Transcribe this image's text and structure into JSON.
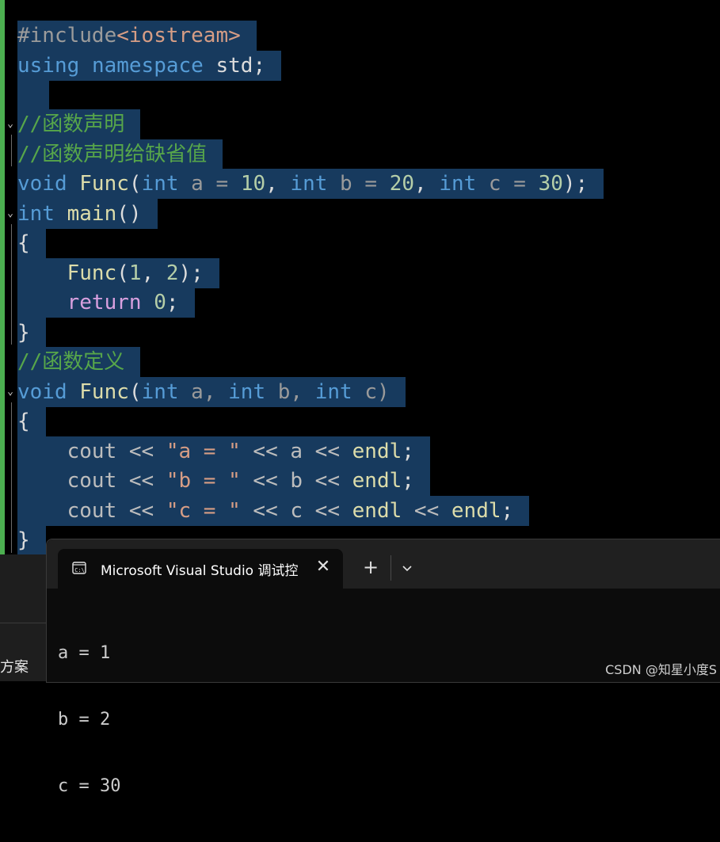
{
  "editor": {
    "lines": [
      {
        "id": "l1",
        "tokens": [
          {
            "t": "#include",
            "c": "pre"
          },
          {
            "t": "<iostream>",
            "c": "inc"
          }
        ]
      },
      {
        "id": "l2",
        "tokens": [
          {
            "t": "using",
            "c": "kw"
          },
          {
            "t": " ",
            "c": "pl"
          },
          {
            "t": "namespace",
            "c": "kw"
          },
          {
            "t": " std;",
            "c": "pl"
          }
        ]
      },
      {
        "id": "l3",
        "tokens": [
          {
            "t": "",
            "c": "pl"
          }
        ]
      },
      {
        "id": "l4",
        "tokens": [
          {
            "t": "//函数声明",
            "c": "cm"
          }
        ]
      },
      {
        "id": "l5",
        "tokens": [
          {
            "t": "//函数声明给缺省值",
            "c": "cm"
          }
        ]
      },
      {
        "id": "l6",
        "tokens": [
          {
            "t": "void",
            "c": "kw"
          },
          {
            "t": " ",
            "c": "pl"
          },
          {
            "t": "Func",
            "c": "fn"
          },
          {
            "t": "(",
            "c": "pl"
          },
          {
            "t": "int",
            "c": "kw"
          },
          {
            "t": " a = ",
            "c": "param"
          },
          {
            "t": "10",
            "c": "num"
          },
          {
            "t": ", ",
            "c": "pl"
          },
          {
            "t": "int",
            "c": "kw"
          },
          {
            "t": " b = ",
            "c": "param"
          },
          {
            "t": "20",
            "c": "num"
          },
          {
            "t": ", ",
            "c": "pl"
          },
          {
            "t": "int",
            "c": "kw"
          },
          {
            "t": " c = ",
            "c": "param"
          },
          {
            "t": "30",
            "c": "num"
          },
          {
            "t": ");",
            "c": "pl"
          }
        ]
      },
      {
        "id": "l7",
        "tokens": [
          {
            "t": "int",
            "c": "kw"
          },
          {
            "t": " ",
            "c": "pl"
          },
          {
            "t": "main",
            "c": "fn"
          },
          {
            "t": "()",
            "c": "pl"
          }
        ]
      },
      {
        "id": "l8",
        "tokens": [
          {
            "t": "{",
            "c": "pl"
          }
        ]
      },
      {
        "id": "l9",
        "tokens": [
          {
            "t": "    ",
            "c": "pl"
          },
          {
            "t": "Func",
            "c": "fn"
          },
          {
            "t": "(",
            "c": "pl"
          },
          {
            "t": "1",
            "c": "num"
          },
          {
            "t": ", ",
            "c": "pl"
          },
          {
            "t": "2",
            "c": "num"
          },
          {
            "t": ");",
            "c": "pl"
          }
        ]
      },
      {
        "id": "l10",
        "tokens": [
          {
            "t": "    ",
            "c": "pl"
          },
          {
            "t": "return",
            "c": "ctrl"
          },
          {
            "t": " ",
            "c": "pl"
          },
          {
            "t": "0",
            "c": "num"
          },
          {
            "t": ";",
            "c": "pl"
          }
        ]
      },
      {
        "id": "l11",
        "tokens": [
          {
            "t": "}",
            "c": "pl"
          }
        ]
      },
      {
        "id": "l12",
        "tokens": [
          {
            "t": "//函数定义",
            "c": "cm"
          }
        ]
      },
      {
        "id": "l13",
        "tokens": [
          {
            "t": "void",
            "c": "kw"
          },
          {
            "t": " ",
            "c": "pl"
          },
          {
            "t": "Func",
            "c": "fn"
          },
          {
            "t": "(",
            "c": "pl"
          },
          {
            "t": "int",
            "c": "kw"
          },
          {
            "t": " a, ",
            "c": "param"
          },
          {
            "t": "int",
            "c": "kw"
          },
          {
            "t": " b, ",
            "c": "param"
          },
          {
            "t": "int",
            "c": "kw"
          },
          {
            "t": " c)",
            "c": "param"
          }
        ]
      },
      {
        "id": "l14",
        "tokens": [
          {
            "t": "{",
            "c": "pl"
          }
        ]
      },
      {
        "id": "l15",
        "tokens": [
          {
            "t": "    cout << ",
            "c": "gr"
          },
          {
            "t": "\"a = \"",
            "c": "str"
          },
          {
            "t": " << a << ",
            "c": "gr"
          },
          {
            "t": "endl",
            "c": "fn"
          },
          {
            "t": ";",
            "c": "pl"
          }
        ]
      },
      {
        "id": "l16",
        "tokens": [
          {
            "t": "    cout << ",
            "c": "gr"
          },
          {
            "t": "\"b = \"",
            "c": "str"
          },
          {
            "t": " << b << ",
            "c": "gr"
          },
          {
            "t": "endl",
            "c": "fn"
          },
          {
            "t": ";",
            "c": "pl"
          }
        ]
      },
      {
        "id": "l17",
        "tokens": [
          {
            "t": "    cout << ",
            "c": "gr"
          },
          {
            "t": "\"c = \"",
            "c": "str"
          },
          {
            "t": " << c << ",
            "c": "gr"
          },
          {
            "t": "endl",
            "c": "fn"
          },
          {
            "t": " << ",
            "c": "gr"
          },
          {
            "t": "endl",
            "c": "fn"
          },
          {
            "t": ";",
            "c": "pl"
          }
        ]
      },
      {
        "id": "l18",
        "tokens": [
          {
            "t": "}",
            "c": "pl"
          }
        ]
      }
    ]
  },
  "left_panel": {
    "label": "方案"
  },
  "terminal": {
    "tab_title": "Microsoft Visual Studio 调试控制台",
    "close_glyph": "✕",
    "new_tab_glyph": "+",
    "output_lines": [
      "a = 1",
      "b = 2",
      "c = 30"
    ]
  },
  "watermark": "CSDN @知星小度S",
  "colors": {
    "selection": "#173a5e",
    "change_bar": "#4caf50",
    "keyword": "#569cd6",
    "function": "#dcdcaa",
    "comment": "#57a64a",
    "number": "#b5cea8",
    "control": "#d8a0df"
  }
}
